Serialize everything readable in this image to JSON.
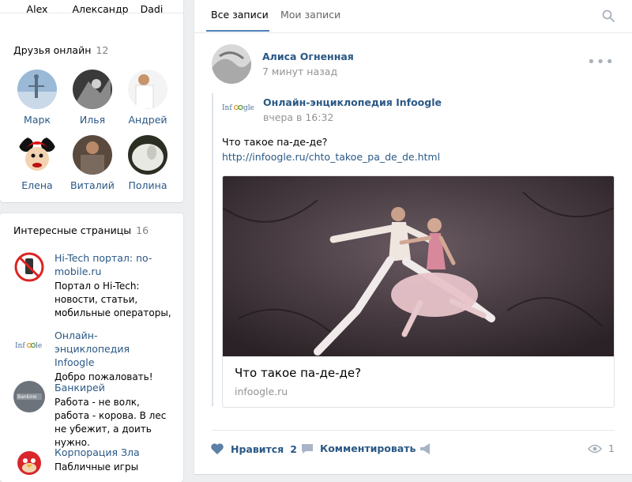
{
  "left": {
    "top_friends": [
      {
        "name": "Alex"
      },
      {
        "name": "Александр"
      },
      {
        "name": "Dadi"
      }
    ],
    "online": {
      "title": "Друзья онлайн",
      "count": "12",
      "friends": [
        {
          "name": "Марк"
        },
        {
          "name": "Илья"
        },
        {
          "name": "Андрей"
        },
        {
          "name": "Елена"
        },
        {
          "name": "Виталий"
        },
        {
          "name": "Полина"
        }
      ]
    },
    "pages": {
      "title": "Интересные страницы",
      "count": "16",
      "items": [
        {
          "name": "Hi-Tech портал: no-mobile.ru",
          "desc": "Портал о Hi-Tech: новости, статьи, мобильные операторы,"
        },
        {
          "name": "Онлайн-энциклопедия Infoogle",
          "desc": "Добро пожаловать!"
        },
        {
          "name": "Банкирей",
          "desc": "Работа - не волк, работа - корова. В лес не убежит, а доить нужно."
        },
        {
          "name": "Корпорация Зла",
          "desc": "Пабличные игры"
        }
      ]
    }
  },
  "feed": {
    "tabs": [
      "Все записи",
      "Мои записи"
    ],
    "post": {
      "author": "Алиса Огненная",
      "time": "7 минут назад",
      "repost": {
        "source": "Онлайн-энциклопедия Infoogle",
        "time": "вчера в 16:32",
        "logo_text": "Infoogle",
        "text": "Что такое па-де-де?",
        "link": "http://infoogle.ru/chto_takoe_pa_de_de.html",
        "attachment": {
          "title": "Что такое па-де-де?",
          "domain": "infoogle.ru"
        }
      },
      "actions": {
        "like_label": "Нравится",
        "like_count": "2",
        "comment_label": "Комментировать",
        "views": "1"
      }
    }
  },
  "icons": {
    "search": "search-icon",
    "more": "more-dots-icon",
    "like": "heart-icon",
    "comment": "comment-icon",
    "share": "megaphone-icon",
    "views": "eye-icon"
  },
  "colors": {
    "link": "#2a5885",
    "accent": "#5181b8",
    "muted": "#939393",
    "background": "#edeef0"
  }
}
